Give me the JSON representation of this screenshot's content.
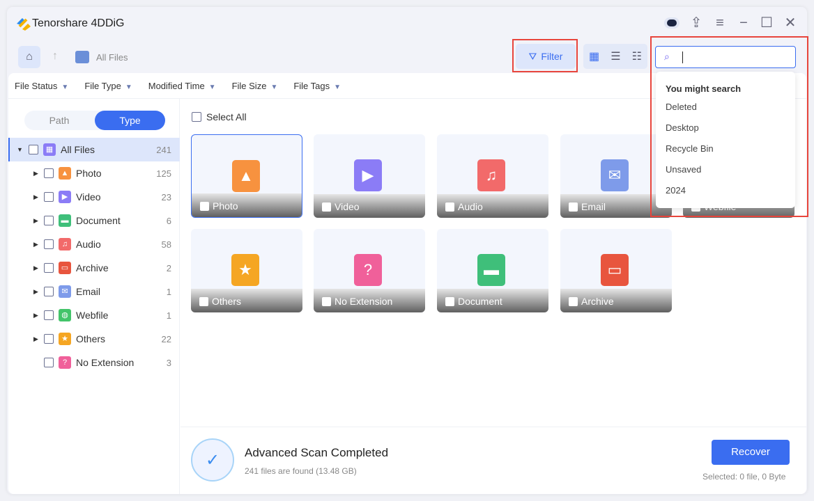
{
  "app": {
    "title": "Tenorshare 4DDiG"
  },
  "toolbar": {
    "breadcrumb": "All Files",
    "filter_label": "Filter"
  },
  "filters": [
    "File Status",
    "File Type",
    "Modified Time",
    "File Size",
    "File Tags"
  ],
  "sidebar": {
    "tabs": [
      "Path",
      "Type"
    ],
    "active_tab": "Type",
    "items": [
      {
        "label": "All Files",
        "count": "241",
        "icon": "grid-icon",
        "color": "#8b7cf6"
      },
      {
        "label": "Photo",
        "count": "125",
        "icon": "photo-icon",
        "color": "#f7923f"
      },
      {
        "label": "Video",
        "count": "23",
        "icon": "video-icon",
        "color": "#8b7cf6"
      },
      {
        "label": "Document",
        "count": "6",
        "icon": "document-icon",
        "color": "#3fbf7a"
      },
      {
        "label": "Audio",
        "count": "58",
        "icon": "audio-icon",
        "color": "#f26a6a"
      },
      {
        "label": "Archive",
        "count": "2",
        "icon": "archive-icon",
        "color": "#e8553e"
      },
      {
        "label": "Email",
        "count": "1",
        "icon": "email-icon",
        "color": "#7e9bea"
      },
      {
        "label": "Webfile",
        "count": "1",
        "icon": "globe-icon",
        "color": "#43c46a"
      },
      {
        "label": "Others",
        "count": "22",
        "icon": "star-icon",
        "color": "#f5a623"
      },
      {
        "label": "No Extension",
        "count": "3",
        "icon": "question-icon",
        "color": "#f0609a"
      }
    ]
  },
  "main": {
    "select_all": "Select All",
    "cards": [
      "Photo",
      "Video",
      "Audio",
      "Email",
      "Webfile",
      "Others",
      "No Extension",
      "Document",
      "Archive"
    ]
  },
  "search": {
    "value": "",
    "suggest_title": "You might search",
    "suggestions": [
      "Deleted",
      "Desktop",
      "Recycle Bin",
      "Unsaved",
      "2024"
    ]
  },
  "status": {
    "title": "Advanced Scan Completed",
    "detail": "241 files are found (13.48 GB)",
    "recover_label": "Recover",
    "selected": "Selected: 0 file, 0 Byte"
  },
  "colors": {
    "accent": "#3a6df0",
    "highlight": "#e8453c"
  }
}
